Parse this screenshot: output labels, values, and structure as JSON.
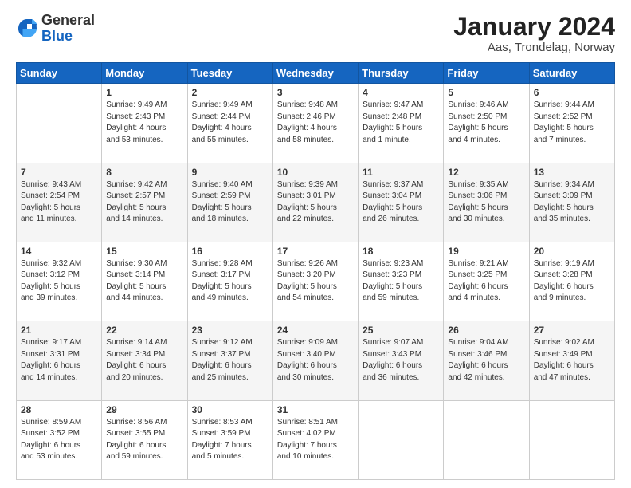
{
  "header": {
    "logo": {
      "general": "General",
      "blue": "Blue"
    },
    "title": "January 2024",
    "location": "Aas, Trondelag, Norway"
  },
  "weekdays": [
    "Sunday",
    "Monday",
    "Tuesday",
    "Wednesday",
    "Thursday",
    "Friday",
    "Saturday"
  ],
  "weeks": [
    [
      {
        "day": null,
        "info": null
      },
      {
        "day": "1",
        "info": "Sunrise: 9:49 AM\nSunset: 2:43 PM\nDaylight: 4 hours\nand 53 minutes."
      },
      {
        "day": "2",
        "info": "Sunrise: 9:49 AM\nSunset: 2:44 PM\nDaylight: 4 hours\nand 55 minutes."
      },
      {
        "day": "3",
        "info": "Sunrise: 9:48 AM\nSunset: 2:46 PM\nDaylight: 4 hours\nand 58 minutes."
      },
      {
        "day": "4",
        "info": "Sunrise: 9:47 AM\nSunset: 2:48 PM\nDaylight: 5 hours\nand 1 minute."
      },
      {
        "day": "5",
        "info": "Sunrise: 9:46 AM\nSunset: 2:50 PM\nDaylight: 5 hours\nand 4 minutes."
      },
      {
        "day": "6",
        "info": "Sunrise: 9:44 AM\nSunset: 2:52 PM\nDaylight: 5 hours\nand 7 minutes."
      }
    ],
    [
      {
        "day": "7",
        "info": "Sunrise: 9:43 AM\nSunset: 2:54 PM\nDaylight: 5 hours\nand 11 minutes."
      },
      {
        "day": "8",
        "info": "Sunrise: 9:42 AM\nSunset: 2:57 PM\nDaylight: 5 hours\nand 14 minutes."
      },
      {
        "day": "9",
        "info": "Sunrise: 9:40 AM\nSunset: 2:59 PM\nDaylight: 5 hours\nand 18 minutes."
      },
      {
        "day": "10",
        "info": "Sunrise: 9:39 AM\nSunset: 3:01 PM\nDaylight: 5 hours\nand 22 minutes."
      },
      {
        "day": "11",
        "info": "Sunrise: 9:37 AM\nSunset: 3:04 PM\nDaylight: 5 hours\nand 26 minutes."
      },
      {
        "day": "12",
        "info": "Sunrise: 9:35 AM\nSunset: 3:06 PM\nDaylight: 5 hours\nand 30 minutes."
      },
      {
        "day": "13",
        "info": "Sunrise: 9:34 AM\nSunset: 3:09 PM\nDaylight: 5 hours\nand 35 minutes."
      }
    ],
    [
      {
        "day": "14",
        "info": "Sunrise: 9:32 AM\nSunset: 3:12 PM\nDaylight: 5 hours\nand 39 minutes."
      },
      {
        "day": "15",
        "info": "Sunrise: 9:30 AM\nSunset: 3:14 PM\nDaylight: 5 hours\nand 44 minutes."
      },
      {
        "day": "16",
        "info": "Sunrise: 9:28 AM\nSunset: 3:17 PM\nDaylight: 5 hours\nand 49 minutes."
      },
      {
        "day": "17",
        "info": "Sunrise: 9:26 AM\nSunset: 3:20 PM\nDaylight: 5 hours\nand 54 minutes."
      },
      {
        "day": "18",
        "info": "Sunrise: 9:23 AM\nSunset: 3:23 PM\nDaylight: 5 hours\nand 59 minutes."
      },
      {
        "day": "19",
        "info": "Sunrise: 9:21 AM\nSunset: 3:25 PM\nDaylight: 6 hours\nand 4 minutes."
      },
      {
        "day": "20",
        "info": "Sunrise: 9:19 AM\nSunset: 3:28 PM\nDaylight: 6 hours\nand 9 minutes."
      }
    ],
    [
      {
        "day": "21",
        "info": "Sunrise: 9:17 AM\nSunset: 3:31 PM\nDaylight: 6 hours\nand 14 minutes."
      },
      {
        "day": "22",
        "info": "Sunrise: 9:14 AM\nSunset: 3:34 PM\nDaylight: 6 hours\nand 20 minutes."
      },
      {
        "day": "23",
        "info": "Sunrise: 9:12 AM\nSunset: 3:37 PM\nDaylight: 6 hours\nand 25 minutes."
      },
      {
        "day": "24",
        "info": "Sunrise: 9:09 AM\nSunset: 3:40 PM\nDaylight: 6 hours\nand 30 minutes."
      },
      {
        "day": "25",
        "info": "Sunrise: 9:07 AM\nSunset: 3:43 PM\nDaylight: 6 hours\nand 36 minutes."
      },
      {
        "day": "26",
        "info": "Sunrise: 9:04 AM\nSunset: 3:46 PM\nDaylight: 6 hours\nand 42 minutes."
      },
      {
        "day": "27",
        "info": "Sunrise: 9:02 AM\nSunset: 3:49 PM\nDaylight: 6 hours\nand 47 minutes."
      }
    ],
    [
      {
        "day": "28",
        "info": "Sunrise: 8:59 AM\nSunset: 3:52 PM\nDaylight: 6 hours\nand 53 minutes."
      },
      {
        "day": "29",
        "info": "Sunrise: 8:56 AM\nSunset: 3:55 PM\nDaylight: 6 hours\nand 59 minutes."
      },
      {
        "day": "30",
        "info": "Sunrise: 8:53 AM\nSunset: 3:59 PM\nDaylight: 7 hours\nand 5 minutes."
      },
      {
        "day": "31",
        "info": "Sunrise: 8:51 AM\nSunset: 4:02 PM\nDaylight: 7 hours\nand 10 minutes."
      },
      {
        "day": null,
        "info": null
      },
      {
        "day": null,
        "info": null
      },
      {
        "day": null,
        "info": null
      }
    ]
  ]
}
